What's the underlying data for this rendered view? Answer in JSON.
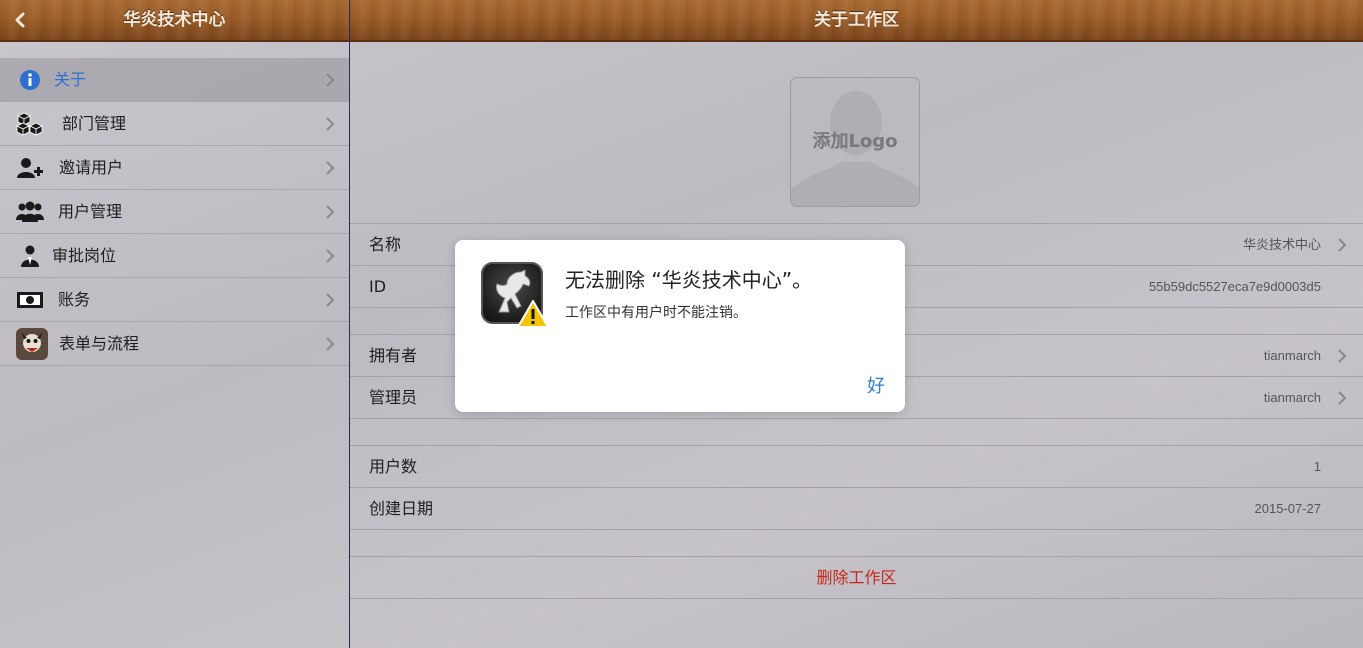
{
  "left_header": {
    "title": "华炎技术中心"
  },
  "right_header": {
    "title": "关于工作区"
  },
  "sidebar": {
    "items": [
      {
        "label": "关于",
        "icon": "info-icon",
        "active": true
      },
      {
        "label": "部门管理",
        "icon": "boxes-icon"
      },
      {
        "label": "邀请用户",
        "icon": "add-user-icon"
      },
      {
        "label": "用户管理",
        "icon": "users-icon"
      },
      {
        "label": "审批岗位",
        "icon": "approver-icon"
      },
      {
        "label": "账务",
        "icon": "money-icon"
      },
      {
        "label": "表单与流程",
        "icon": "forms-app-icon"
      }
    ]
  },
  "logo": {
    "label": "添加Logo"
  },
  "workspace": {
    "name_label": "名称",
    "name_value": "华炎技术中心",
    "id_label": "ID",
    "id_value": "55b59dc5527eca7e9d0003d5",
    "owner_label": "拥有者",
    "owner_value": "tianmarch",
    "admin_label": "管理员",
    "admin_value": "tianmarch",
    "users_label": "用户数",
    "users_value": "1",
    "created_label": "创建日期",
    "created_value": "2015-07-27",
    "delete_label": "删除工作区"
  },
  "alert": {
    "title": "无法删除 “华炎技术中心”。",
    "message": "工作区中有用户时不能注销。",
    "ok_label": "好"
  },
  "colors": {
    "accent_blue": "#2f7fd1",
    "danger_red": "#c4281c",
    "wood": "#9a5d28"
  }
}
